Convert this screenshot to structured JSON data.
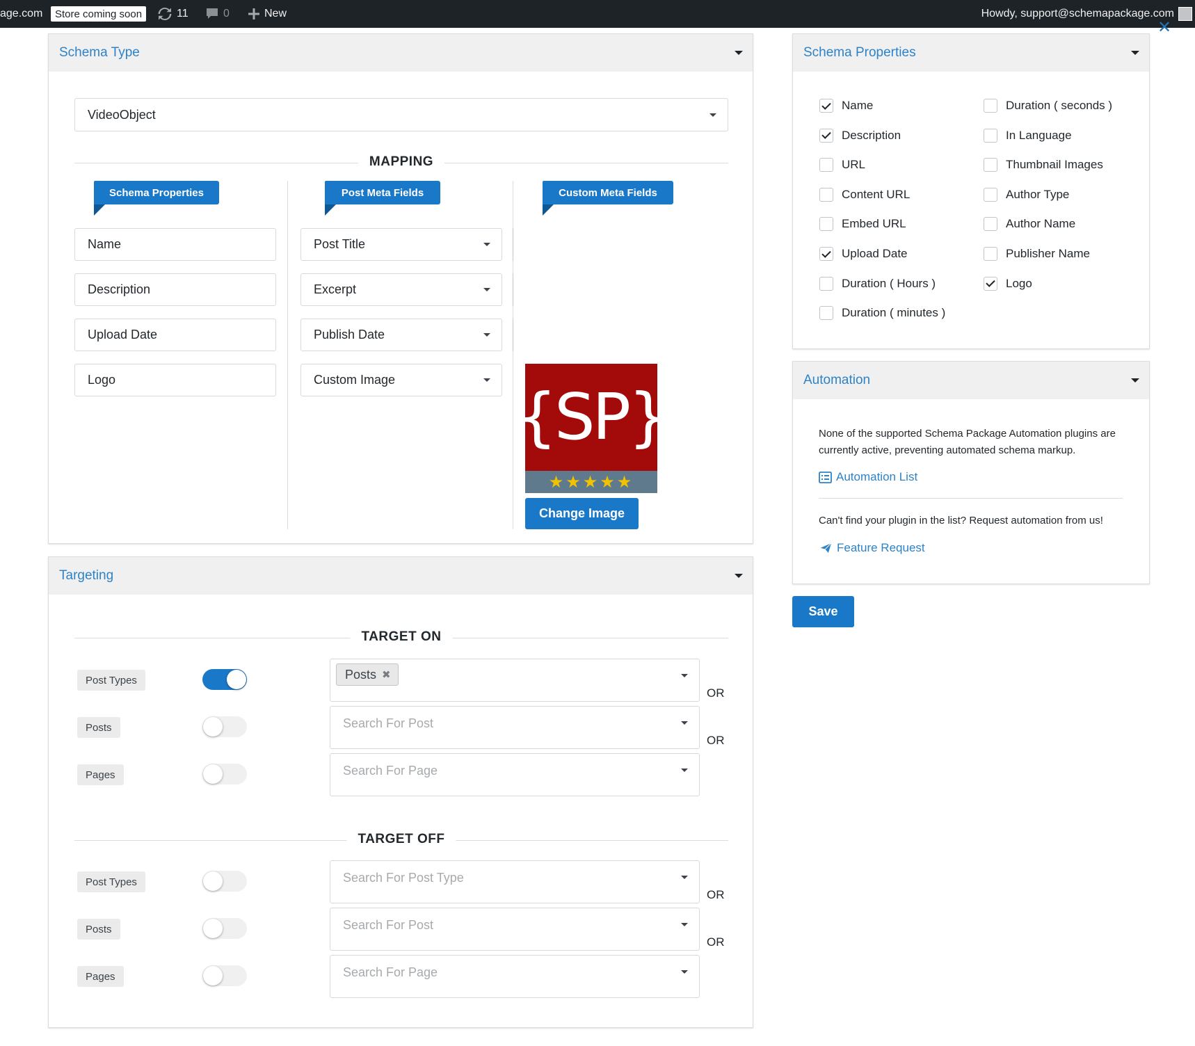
{
  "admin_bar": {
    "site_fragment": "age.com",
    "store_badge": "Store coming soon",
    "updates_count": "11",
    "comments_count": "0",
    "new_label": "New",
    "howdy": "Howdy, support@schemapackage.com"
  },
  "schema_type": {
    "title": "Schema Type",
    "selected": "VideoObject",
    "mapping_heading": "MAPPING",
    "columns": [
      "Schema Properties",
      "Post Meta Fields",
      "Custom Meta Fields"
    ],
    "rows": [
      {
        "property": "Name",
        "field": "Post Title"
      },
      {
        "property": "Description",
        "field": "Excerpt"
      },
      {
        "property": "Upload Date",
        "field": "Publish Date"
      },
      {
        "property": "Logo",
        "field": "Custom Image"
      }
    ],
    "logo_text": "{SP}",
    "stars": "★★★★★",
    "change_image_button": "Change Image"
  },
  "targeting": {
    "title": "Targeting",
    "target_on": {
      "heading": "TARGET ON",
      "rows": [
        {
          "label": "Post Types",
          "toggle_on": true,
          "chip": "Posts",
          "placeholder": ""
        },
        {
          "label": "Posts",
          "toggle_on": false,
          "placeholder": "Search For Post"
        },
        {
          "label": "Pages",
          "toggle_on": false,
          "placeholder": "Search For Page"
        }
      ]
    },
    "target_off": {
      "heading": "TARGET OFF",
      "rows": [
        {
          "label": "Post Types",
          "toggle_on": false,
          "placeholder": "Search For Post Type"
        },
        {
          "label": "Posts",
          "toggle_on": false,
          "placeholder": "Search For Post"
        },
        {
          "label": "Pages",
          "toggle_on": false,
          "placeholder": "Search For Page"
        }
      ]
    },
    "or_label": "OR"
  },
  "schema_properties": {
    "title": "Schema Properties",
    "left": [
      {
        "label": "Name",
        "checked": true
      },
      {
        "label": "Description",
        "checked": true
      },
      {
        "label": "URL",
        "checked": false
      },
      {
        "label": "Content URL",
        "checked": false
      },
      {
        "label": "Embed URL",
        "checked": false
      },
      {
        "label": "Upload Date",
        "checked": true
      },
      {
        "label": "Duration ( Hours )",
        "checked": false
      },
      {
        "label": "Duration ( minutes )",
        "checked": false
      }
    ],
    "right": [
      {
        "label": "Duration ( seconds )",
        "checked": false
      },
      {
        "label": "In Language",
        "checked": false
      },
      {
        "label": "Thumbnail Images",
        "checked": false
      },
      {
        "label": "Author Type",
        "checked": false
      },
      {
        "label": "Author Name",
        "checked": false
      },
      {
        "label": "Publisher Name",
        "checked": false
      },
      {
        "label": "Logo",
        "checked": true
      }
    ]
  },
  "automation": {
    "title": "Automation",
    "notice": "None of the supported Schema Package Automation plugins are currently active, preventing automated schema markup.",
    "list_link": "Automation List",
    "request_text": "Can't find your plugin in the list? Request automation from us!",
    "feature_link": "Feature Request"
  },
  "save_button": "Save",
  "colors": {
    "accent": "#1a78c8",
    "title_blue": "#2e82c6",
    "logo_red": "#a30b0b",
    "logo_bar": "#5f7a8c",
    "star": "#f2c200"
  }
}
